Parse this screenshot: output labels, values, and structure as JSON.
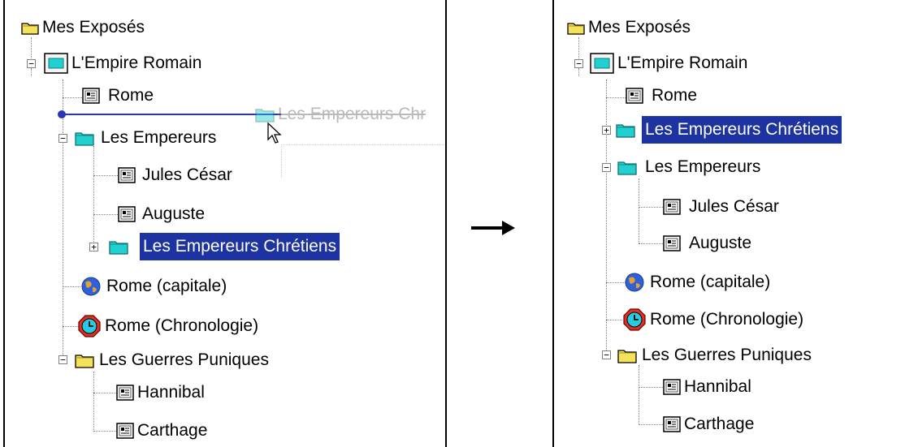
{
  "left_panel": {
    "root": "Mes Exposés",
    "empire": "L'Empire Romain",
    "rome": "Rome",
    "drag_ghost": "Les Empereurs Chr",
    "empereurs": "Les Empereurs",
    "jules": "Jules César",
    "auguste": "Auguste",
    "chretiens": "Les Empereurs Chrétiens",
    "rome_capitale": "Rome (capitale)",
    "rome_chrono": "Rome (Chronologie)",
    "guerres": "Les Guerres Puniques",
    "hannibal": "Hannibal",
    "carthage": "Carthage"
  },
  "right_panel": {
    "root": "Mes Exposés",
    "empire": "L'Empire Romain",
    "rome": "Rome",
    "chretiens": "Les Empereurs Chrétiens",
    "empereurs": "Les Empereurs",
    "jules": "Jules César",
    "auguste": "Auguste",
    "rome_capitale": "Rome (capitale)",
    "rome_chrono": "Rome (Chronologie)",
    "guerres": "Les Guerres Puniques",
    "hannibal": "Hannibal",
    "carthage": "Carthage"
  },
  "icons": {
    "folder": "folder-icon",
    "presentation": "presentation-icon",
    "document": "document-icon",
    "globe": "globe-icon",
    "clock": "clock-icon"
  },
  "colors": {
    "selection": "#1e33a2",
    "drop_indicator": "#2a35b5",
    "folder_yellow": "#f5e15a",
    "folder_cyan": "#22d0d0"
  }
}
